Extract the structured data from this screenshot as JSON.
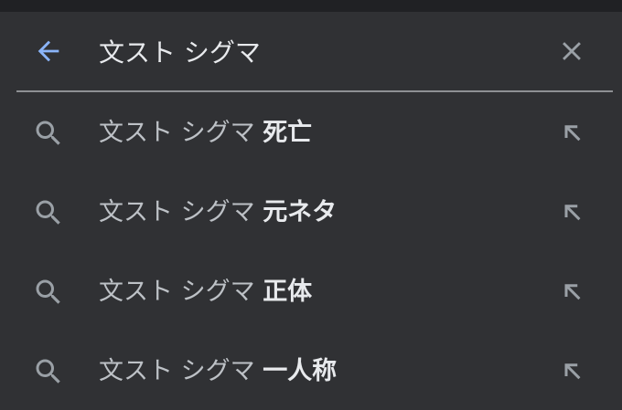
{
  "search": {
    "query": "文スト シグマ",
    "back_icon": "arrow-back-icon",
    "clear_icon": "close-icon"
  },
  "colors": {
    "background": "#303134",
    "top_bar": "#202124",
    "accent_blue": "#8ab4f8",
    "text_primary": "#e8eaed",
    "text_secondary": "#bdc1c6",
    "icon_gray": "#9aa0a6"
  },
  "suggestions": [
    {
      "prefix": "文スト シグマ",
      "suffix": "死亡",
      "icon": "search-icon",
      "action_icon": "arrow-up-left-icon"
    },
    {
      "prefix": "文スト シグマ",
      "suffix": "元ネタ",
      "icon": "search-icon",
      "action_icon": "arrow-up-left-icon"
    },
    {
      "prefix": "文スト シグマ",
      "suffix": "正体",
      "icon": "search-icon",
      "action_icon": "arrow-up-left-icon"
    },
    {
      "prefix": "文スト シグマ",
      "suffix": "一人称",
      "icon": "search-icon",
      "action_icon": "arrow-up-left-icon"
    }
  ]
}
